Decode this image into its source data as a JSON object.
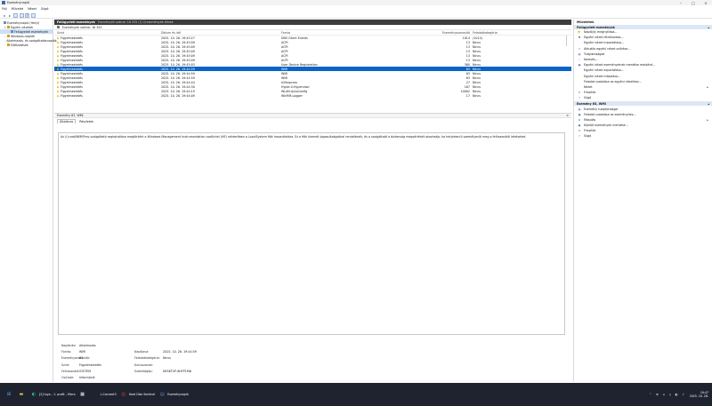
{
  "window": {
    "title": "Eseménynapló",
    "min": "–",
    "max": "□",
    "close": "×"
  },
  "menu": [
    "Fájl",
    "Művelet",
    "Nézet",
    "Súgó"
  ],
  "tree": [
    {
      "label": "Eseménynapló (Helyi)",
      "expand": "",
      "level": 0
    },
    {
      "label": "Egyéni nézetek",
      "expand": "▾",
      "level": 1
    },
    {
      "label": "Felügyeleti események",
      "expand": "",
      "level": 2,
      "selected": true
    },
    {
      "label": "Windows-naplók",
      "expand": "›",
      "level": 1
    },
    {
      "label": "Alkalmazás- és szolgáltatásnaplók",
      "expand": "›",
      "level": 1
    },
    {
      "label": "Előfizetések",
      "expand": "",
      "level": 1
    }
  ],
  "center": {
    "title": "Felügyeleti események",
    "subtitle": "Események száma: 16 335 (!) Új események állnak",
    "filter": "Események száma: 16 343"
  },
  "grid": {
    "columns": [
      "Szint",
      "Dátum és idő",
      "Forrás",
      "Eseményazonosító",
      "Feladatkategória"
    ],
    "rows": [
      [
        "Figyelmeztetés",
        "2025. 10. 26. 19:45:27",
        "DNS Client Events",
        "1014",
        "(1014)"
      ],
      [
        "Figyelmeztetés",
        "2025. 10. 26. 19:45:09",
        "ACPI",
        "13",
        "Nincs"
      ],
      [
        "Figyelmeztetés",
        "2025. 10. 26. 19:45:09",
        "ACPI",
        "13",
        "Nincs"
      ],
      [
        "Figyelmeztetés",
        "2025. 10. 26. 19:45:09",
        "ACPI",
        "13",
        "Nincs"
      ],
      [
        "Figyelmeztetés",
        "2025. 10. 26. 19:45:09",
        "ACPI",
        "13",
        "Nincs"
      ],
      [
        "Figyelmeztetés",
        "2025. 10. 26. 19:45:09",
        "ACPI",
        "13",
        "Nincs"
      ],
      [
        "Figyelmeztetés",
        "2025. 10. 26. 19:45:03",
        "User Device Registration",
        "360",
        "Nincs"
      ],
      [
        "Figyelmeztetés",
        "2025. 10. 26. 19:44:59",
        "WMI",
        "63",
        "Nincs"
      ],
      [
        "Figyelmeztetés",
        "2025. 10. 26. 19:44:59",
        "WMI",
        "63",
        "Nincs"
      ],
      [
        "Figyelmeztetés",
        "2025. 10. 26. 19:44:59",
        "WMI",
        "63",
        "Nincs"
      ],
      [
        "Figyelmeztetés",
        "2025. 10. 26. 19:44:44",
        "e2fexpress",
        "27",
        "Nincs"
      ],
      [
        "Figyelmeztetés",
        "2025. 10. 26. 19:44:30",
        "Hyper-V-Hypervisor",
        "167",
        "Nincs"
      ],
      [
        "Figyelmeztetés",
        "2025. 10. 26. 19:44:19",
        "WLAN-AutoConfig",
        "10002",
        "Nincs"
      ],
      [
        "Figyelmeztetés",
        "2025. 10. 26. 19:44:09",
        "WinRM-Logger",
        "17",
        "Nincs"
      ]
    ],
    "selected_row": 7
  },
  "details": {
    "header": "Esemény 63, WMI",
    "close": "×",
    "tabs": [
      "Általános",
      "Részletek"
    ],
    "message": "Az \\\\.\\root\\WMI\\Prov szolgáltató regisztrálása megtörtént a Windows Management Instrumentation root\\Intel (HE) névterében a LocalSystem fiók használatára. Ez a fiók kiemelt jogosultságokkal rendelkezik, és a szolgáltató a biztonság megsértését okozhatja, ha helytelenül személyesíti meg a felhasználói kéréseket.",
    "props": {
      "naplonev_label": "Naplónév:",
      "naplonev": "Alkalmazás",
      "forras_label": "Forrás:",
      "forras": "WMI",
      "naplozva_label": "Naplózva:",
      "naplozva": "2025. 10. 26. 19:44:59",
      "azon_label": "Eseményazonosító:",
      "azon": "63",
      "feladat_label": "Feladatkategória:",
      "feladat": "Nincs",
      "szint_label": "Szint:",
      "szint": "Figyelmeztetés",
      "kulcs_label": "Kulcsszavak:",
      "kulcs": "",
      "felh_label": "Felhasználó:",
      "felh": "SYSTEM",
      "szg_label": "Számítógép:",
      "szg": "DESKTOP-6HFP1M6",
      "opcode_label": "OpCode:",
      "opcode": "Információ"
    }
  },
  "actions": {
    "title": "Műveletek",
    "section1": "Felügyeleti események",
    "items1": [
      {
        "icon": "folder-open-icon",
        "glyph": "📂",
        "label": "Napló(k) megnyitása...",
        "arrow": ""
      },
      {
        "icon": "filter-icon",
        "glyph": "▼",
        "label": "Egyéni nézet létrehozása...",
        "arrow": ""
      },
      {
        "icon": "import-icon",
        "glyph": "",
        "label": "Egyéni nézet importálása...",
        "arrow": ""
      },
      {
        "icon": "filter-clear-icon",
        "glyph": "▽",
        "label": "Aktuális egyéni nézet szűrése...",
        "arrow": ""
      },
      {
        "icon": "properties-icon",
        "glyph": "▤",
        "label": "Tulajdonságok",
        "arrow": ""
      },
      {
        "icon": "find-icon",
        "glyph": "⌕",
        "label": "Keresés...",
        "arrow": ""
      },
      {
        "icon": "save-icon",
        "glyph": "▣",
        "label": "Egyéni nézet eseményeinek mentése másként...",
        "arrow": ""
      },
      {
        "icon": "export-icon",
        "glyph": "",
        "label": "Egyéni nézet exportálása...",
        "arrow": ""
      },
      {
        "icon": "copy-icon",
        "glyph": "",
        "label": "Egyéni nézet másolása...",
        "arrow": ""
      },
      {
        "icon": "attach-task-icon",
        "glyph": "",
        "label": "Feladat csatolása az egyéni nézethez...",
        "arrow": ""
      },
      {
        "icon": "view-icon",
        "glyph": "",
        "label": "Nézet",
        "arrow": "▸"
      },
      {
        "icon": "refresh-icon",
        "glyph": "⟳",
        "label": "Frissítés",
        "arrow": ""
      },
      {
        "icon": "help-icon",
        "glyph": "?",
        "label": "Súgó",
        "arrow": ""
      }
    ],
    "section2": "Esemény 63, WMI",
    "items2": [
      {
        "icon": "event-properties-icon",
        "glyph": "▤",
        "label": "Esemény tulajdonságai",
        "arrow": ""
      },
      {
        "icon": "attach-task-icon",
        "glyph": "▦",
        "label": "Feladat csatolása az eseményhez...",
        "arrow": ""
      },
      {
        "icon": "copy-icon",
        "glyph": "⧉",
        "label": "Másolás",
        "arrow": "▸"
      },
      {
        "icon": "save-icon",
        "glyph": "▣",
        "label": "Kijelölt események mentése...",
        "arrow": ""
      },
      {
        "icon": "refresh-icon",
        "glyph": "⟳",
        "label": "Frissítés",
        "arrow": ""
      },
      {
        "icon": "help-icon",
        "glyph": "?",
        "label": "Súgó",
        "arrow": ""
      }
    ]
  },
  "taskbar": {
    "items": [
      {
        "name": "start-button",
        "glyph": "⊞",
        "label": "",
        "color": "#4da3ff"
      },
      {
        "name": "file-explorer-button",
        "glyph": "▬",
        "label": "",
        "color": "#f2c14e"
      },
      {
        "name": "edge-button",
        "glyph": "◐",
        "label": "[2] tuyo – 1. profil – Micro",
        "color": "#2fb8a8"
      },
      {
        "name": "ms-store-button",
        "glyph": "▦",
        "label": "",
        "color": "#ffffff"
      },
      {
        "name": "lconnect3-button",
        "glyph": "▮",
        "label": "L-Connect3",
        "color": "#222222"
      },
      {
        "name": "hard-disk-sentinel-button",
        "glyph": "▥",
        "label": "Hard Disk Sentinel",
        "color": "#c0392b"
      },
      {
        "name": "event-viewer-button",
        "glyph": "▤",
        "label": "Eseménynapló",
        "color": "#5a7fb5"
      }
    ],
    "tray": [
      "⌃",
      "⊕",
      "⌂",
      "▯",
      "◧",
      "♪"
    ],
    "time": "19:47",
    "date": "2025. 10. 26."
  }
}
